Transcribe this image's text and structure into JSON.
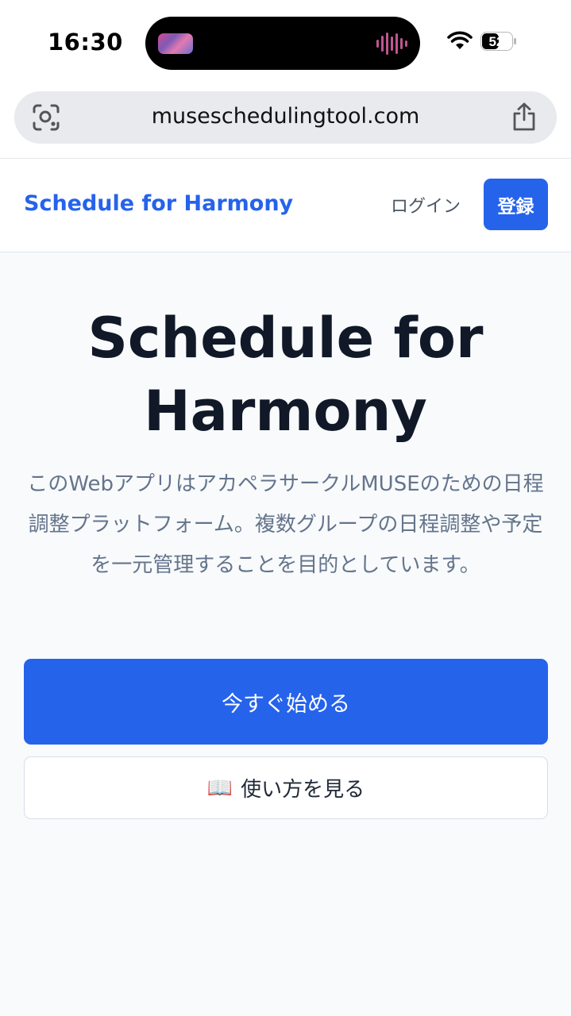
{
  "status_bar": {
    "time": "16:30",
    "battery": "52"
  },
  "browser": {
    "url": "museschedulingtool.com"
  },
  "header": {
    "brand": "Schedule for Harmony",
    "login": "ログイン",
    "register": "登録"
  },
  "hero": {
    "title": "Schedule for Harmony",
    "description": "このWebアプリはアカペラサークルMUSEのための日程調整プラットフォーム。複数グループの日程調整や予定を一元管理することを目的としています。",
    "start_button": "今すぐ始める",
    "guide_icon": "📖",
    "guide_button": "使い方を見る"
  },
  "colors": {
    "accent": "#2563eb",
    "title": "#111827",
    "muted": "#64748b",
    "background": "#f8fafc"
  },
  "icons": [
    "visual-search-icon",
    "share-icon",
    "wifi-icon",
    "battery-icon",
    "book-icon"
  ]
}
